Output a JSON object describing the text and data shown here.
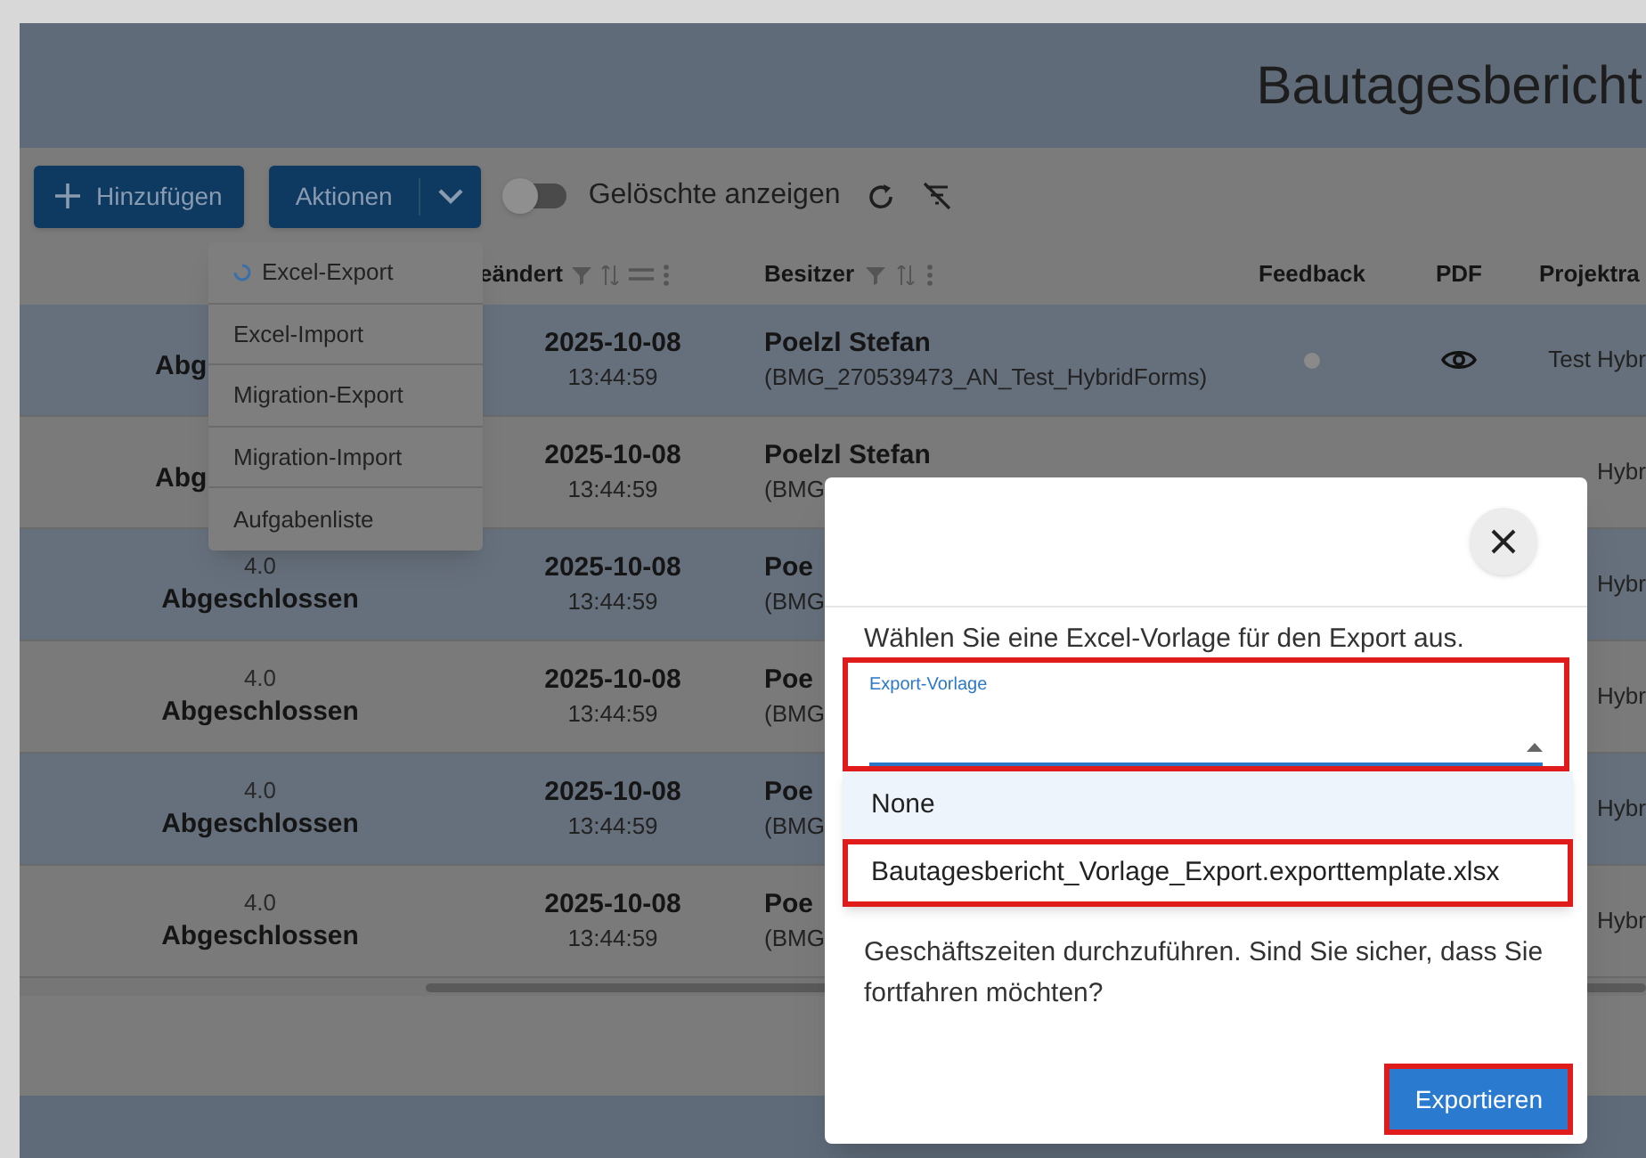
{
  "header": {
    "title": "Bautagesbericht"
  },
  "toolbar": {
    "add_button": "Hinzufügen",
    "actions_button": "Aktionen",
    "show_deleted": {
      "label": "Gelöschte anzeigen",
      "on": false
    }
  },
  "actions_menu": [
    {
      "label": "Excel-Export",
      "loading": true
    },
    {
      "label": "Excel-Import",
      "loading": false
    },
    {
      "label": "Migration-Export",
      "loading": false
    },
    {
      "label": "Migration-Import",
      "loading": false
    },
    {
      "label": "Aufgabenliste",
      "loading": false
    }
  ],
  "table": {
    "columns": [
      "eändert",
      "Besitzer",
      "Feedback",
      "PDF",
      "Projektra"
    ],
    "rows": [
      {
        "version": "",
        "status": "Abg",
        "date": "2025-10-08",
        "time": "13:44:59",
        "owner": "Poelzl Stefan",
        "owner_detail": "(BMG_270539473_AN_Test_HybridForms)",
        "feedback": true,
        "pdf": true,
        "project": "Test Hybr"
      },
      {
        "version": "",
        "status": "Abg",
        "date": "2025-10-08",
        "time": "13:44:59",
        "owner": "Poelzl Stefan",
        "owner_detail": "(BMG",
        "project": "Hybr"
      },
      {
        "version": "4.0",
        "status": "Abgeschlossen",
        "date": "2025-10-08",
        "time": "13:44:59",
        "owner": "Poe",
        "owner_detail": "(BMG",
        "project": "Hybr"
      },
      {
        "version": "4.0",
        "status": "Abgeschlossen",
        "date": "2025-10-08",
        "time": "13:44:59",
        "owner": "Poe",
        "owner_detail": "(BMG",
        "project": "Hybr"
      },
      {
        "version": "4.0",
        "status": "Abgeschlossen",
        "date": "2025-10-08",
        "time": "13:44:59",
        "owner": "Poe",
        "owner_detail": "(BMG",
        "project": "Hybr"
      },
      {
        "version": "4.0",
        "status": "Abgeschlossen",
        "date": "2025-10-08",
        "time": "13:44:59",
        "owner": "Poe",
        "owner_detail": "(BMG",
        "project": "Hybr"
      }
    ]
  },
  "dialog": {
    "prompt": "Wählen Sie eine Excel-Vorlage für den Export aus.",
    "select": {
      "label": "Export-Vorlage",
      "highlighted": true
    },
    "options": [
      {
        "label": "None",
        "selected": false,
        "highlighted": false
      },
      {
        "label": "Bautagesbericht_Vorlage_Export.exporttemplate.xlsx",
        "selected": false,
        "highlighted": true
      }
    ],
    "message": "Geschäftszeiten durchzuführen. Sind Sie sicher, dass Sie fortfahren möchten?",
    "button": {
      "label": "Exportieren",
      "highlighted": true
    }
  }
}
